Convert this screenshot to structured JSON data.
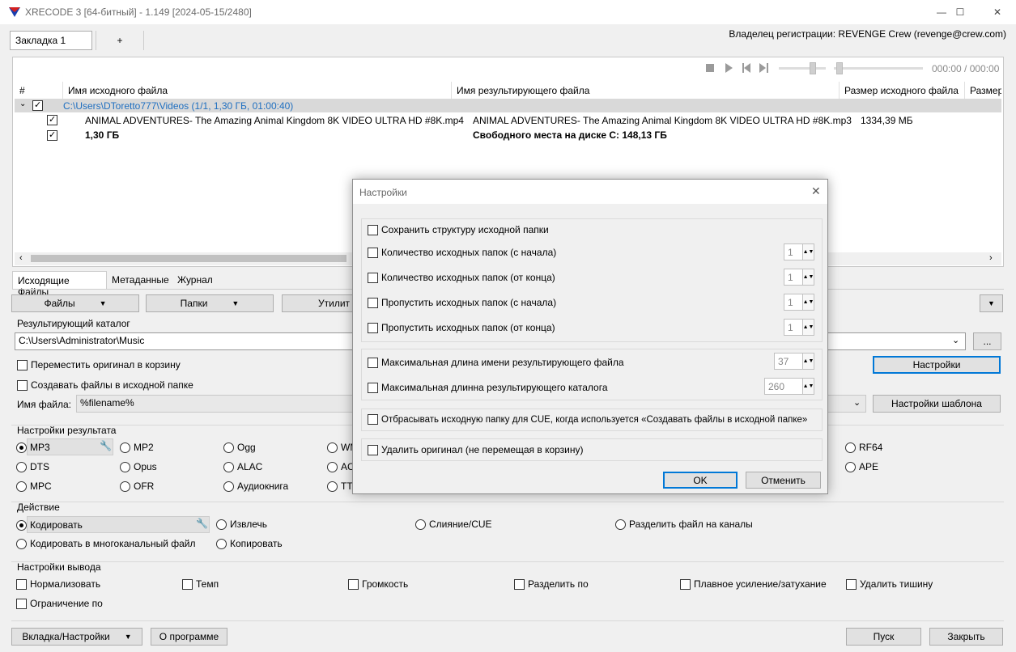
{
  "window": {
    "title": "XRECODE 3 [64-битный] - 1.149 [2024-05-15/2480]",
    "minimize": "—",
    "maximize": "☐",
    "close": "✕"
  },
  "tabs": {
    "active": "Закладка 1",
    "add": "+"
  },
  "registration": "Владелец регистрации: REVENGE Crew (revenge@crew.com)",
  "player": {
    "time": "000:00 / 000:00"
  },
  "table": {
    "columns": [
      "#",
      "Имя исходного файла",
      "Имя результирующего файла",
      "Размер исходного файла",
      "Размер"
    ],
    "group": "C:\\Users\\DToretto777\\Videos (1/1, 1,30 ГБ, 01:00:40)",
    "row": {
      "source": "ANIMAL ADVENTURES- The Amazing Animal Kingdom 8K VIDEO ULTRA HD #8K.mp4",
      "target": "ANIMAL ADVENTURES- The Amazing Animal Kingdom 8K VIDEO ULTRA HD #8K.mp3",
      "size": "1334,39 МБ"
    },
    "total": {
      "size": "1,30 ГБ",
      "free": "Свободного места на диске C: 148,13 ГБ"
    }
  },
  "bottom_tabs": [
    "Исходящие Файлы",
    "Метаданные",
    "Журнал"
  ],
  "toolbar": {
    "files": "Файлы",
    "folders": "Папки",
    "utils": "Утилит"
  },
  "output": {
    "header": "Результирующий каталог",
    "path": "C:\\Users\\Administrator\\Music",
    "browse": "...",
    "move_to_bin": "Переместить оригинал в корзину",
    "create_in_source": "Создавать файлы в исходной папке",
    "filename_label": "Имя файла:",
    "filename_value": "%filename%",
    "settings_btn": "Настройки",
    "template_btn": "Настройки шаблона"
  },
  "result_settings": {
    "header": "Настройки результата",
    "formats": [
      "MP3",
      "MP2",
      "Ogg",
      "WM",
      "DTS",
      "Opus",
      "ALAC",
      "AC",
      "MPC",
      "OFR",
      "Аудиокнига",
      "TTA",
      "RF64",
      "APE"
    ]
  },
  "action": {
    "header": "Действие",
    "encode": "Кодировать",
    "extract": "Извлечь",
    "merge": "Слияние/CUE",
    "split_channels": "Разделить файл на каналы",
    "encode_multi": "Кодировать в многоканальный файл",
    "copy": "Копировать"
  },
  "output_settings": {
    "header": "Настройки вывода",
    "items": [
      "Нормализовать",
      "Темп",
      "Громкость",
      "Разделить по",
      "Плавное усиление/затухание",
      "Удалить тишину",
      "Ограничение по"
    ]
  },
  "footer": {
    "tab_settings": "Вкладка/Настройки",
    "about": "О программе",
    "start": "Пуск",
    "close": "Закрыть"
  },
  "dialog": {
    "title": "Настройки",
    "keep_structure": "Сохранить структуру исходной папки",
    "count_start": "Количество исходных папок (с начала)",
    "count_end": "Количество исходных папок (от конца)",
    "skip_start": "Пропустить исходных папок (с начала)",
    "skip_end": "Пропустить исходных папок (от конца)",
    "spin_values": [
      "1",
      "1",
      "1",
      "1"
    ],
    "max_name": "Максимальная длина имени результирующего файла",
    "max_name_val": "37",
    "max_dir": "Максимальная длинна результирующего каталога",
    "max_dir_val": "260",
    "cue_drop": "Отбрасывать исходную папку для CUE, когда используется «Создавать файлы в исходной папке»",
    "delete_orig": "Удалить оригинал (не перемещая в корзину)",
    "ok": "OK",
    "cancel": "Отменить"
  }
}
